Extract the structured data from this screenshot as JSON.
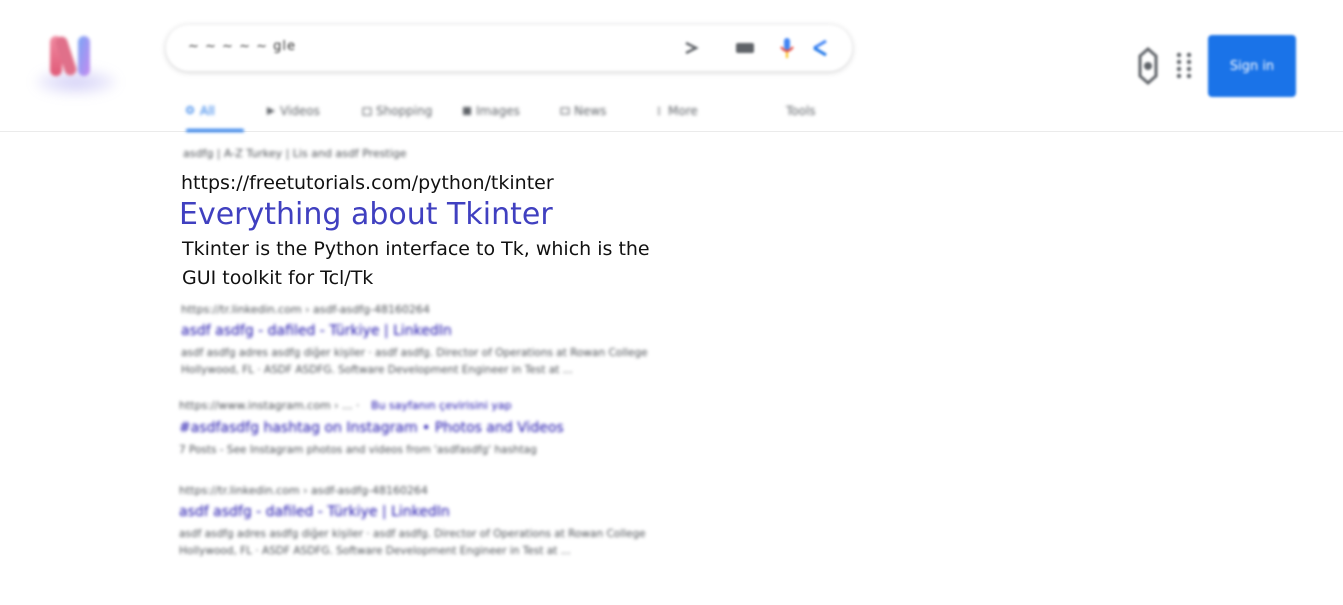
{
  "search": {
    "query": "~ ~ ~ ~ ~ gle"
  },
  "tabs": [
    {
      "label": "All",
      "icon": "search-icon",
      "active": true
    },
    {
      "label": "Videos",
      "icon": "video-icon",
      "active": false
    },
    {
      "label": "Shopping",
      "icon": "shopping-icon",
      "active": false
    },
    {
      "label": "Images",
      "icon": "image-icon",
      "active": false
    },
    {
      "label": "News",
      "icon": "news-icon",
      "active": false
    },
    {
      "label": "More",
      "icon": "more-icon",
      "active": false
    },
    {
      "label": "Tools",
      "icon": "",
      "active": false
    }
  ],
  "header": {
    "signin_label": "Sign in"
  },
  "featured": {
    "breadcrumb": "asdfg | A-Z Turkey | Lis and asdf Prestige",
    "url": "https://freetutorials.com/python/tkinter",
    "title": "Everything about Tkinter",
    "description": "Tkinter is the Python interface to Tk, which is the GUI toolkit for Tcl/Tk"
  },
  "results": [
    {
      "cite": "https://tr.linkedin.com › asdf-asdfg-48160264",
      "title": "asdf asdfg - dafiled - Türkiye | LinkedIn",
      "snippet1": "asdf asdfg adres asdfg diğer kişiler · asdf asdfg. Director of Operations at Rowan College",
      "snippet2": "Hollywood, FL · ASDF ASDFG. Software Development Engineer in Test at ..."
    },
    {
      "cite": "https://www.instagram.com › ... ·",
      "cite_extra": "Bu sayfanın çevirisini yap",
      "title": "#asdfasdfg hashtag on Instagram • Photos and Videos",
      "snippet1": "7 Posts - See Instagram photos and videos from 'asdfasdfg' hashtag"
    },
    {
      "cite": "https://tr.linkedin.com › asdf-asdfg-48160264",
      "title": "asdf asdfg - dafiled - Türkiye | LinkedIn",
      "snippet1": "asdf asdfg adres asdfg diğer kişiler · asdf asdfg. Director of Operations at Rowan College",
      "snippet2": "Hollywood, FL · ASDF ASDFG. Software Development Engineer in Test at ..."
    }
  ],
  "colors": {
    "accent": "#1a73e8",
    "link": "#1a0dab",
    "featured_title": "#4040c0"
  }
}
